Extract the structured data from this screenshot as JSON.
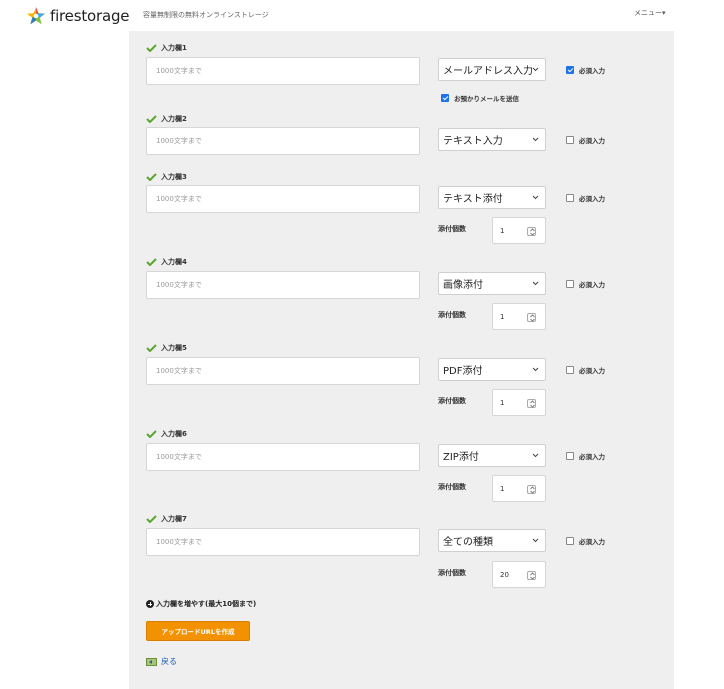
{
  "header": {
    "logo_text": "firestorage",
    "tagline": "容量無制限の無料オンラインストレージ",
    "menu_label": "メニュー▾"
  },
  "fields": [
    {
      "label": "入力欄1",
      "placeholder": "1000文字まで",
      "type": "メールアドレス入力",
      "required_label": "必須入力",
      "required_checked": true
    },
    {
      "label": "入力欄2",
      "placeholder": "1000文字まで",
      "type": "テキスト入力",
      "required_label": "必須入力",
      "required_checked": false
    },
    {
      "label": "入力欄3",
      "placeholder": "1000文字まで",
      "type": "テキスト添付",
      "required_label": "必須入力",
      "required_checked": false,
      "attach_label": "添付個数",
      "attach_count": "1"
    },
    {
      "label": "入力欄4",
      "placeholder": "1000文字まで",
      "type": "画像添付",
      "required_label": "必須入力",
      "required_checked": false,
      "attach_label": "添付個数",
      "attach_count": "1"
    },
    {
      "label": "入力欄5",
      "placeholder": "1000文字まで",
      "type": "PDF添付",
      "required_label": "必須入力",
      "required_checked": false,
      "attach_label": "添付個数",
      "attach_count": "1"
    },
    {
      "label": "入力欄6",
      "placeholder": "1000文字まで",
      "type": "ZIP添付",
      "required_label": "必須入力",
      "required_checked": false,
      "attach_label": "添付個数",
      "attach_count": "1"
    },
    {
      "label": "入力欄7",
      "placeholder": "1000文字まで",
      "type": "全ての種類",
      "required_label": "必須入力",
      "required_checked": false,
      "attach_label": "添付個数",
      "attach_count": "20"
    }
  ],
  "send_mail": {
    "label": "お預かりメールを送信",
    "checked": true
  },
  "add_field_label": "入力欄を増やす(最大10個まで)",
  "create_button_label": "アップロードURLを作成",
  "back_label": "戻る",
  "colors": {
    "accent": "#f39200",
    "check": "#5aa531",
    "link": "#1a5fb4",
    "checkbox": "#1a73e8"
  },
  "icons": [
    "firestorage-star-logo",
    "check-icon",
    "chevron-down-icon",
    "spin-icon",
    "plus-circle-icon",
    "back-icon"
  ]
}
